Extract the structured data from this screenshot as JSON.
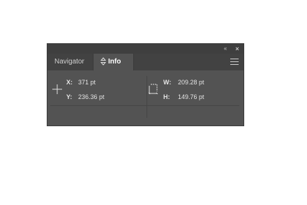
{
  "window": {
    "collapse_icon": "«",
    "close_icon": "×"
  },
  "tabs": [
    {
      "label": "Navigator",
      "active": false
    },
    {
      "label": "Info",
      "active": true
    }
  ],
  "info": {
    "x_label": "X:",
    "x_value": "371 pt",
    "y_label": "Y:",
    "y_value": "236.36 pt",
    "w_label": "W:",
    "w_value": "209.28 pt",
    "h_label": "H:",
    "h_value": "149.76 pt"
  },
  "icons": {
    "position": "crosshair-icon",
    "size": "rectangle-size-icon",
    "menu": "hamburger-menu-icon",
    "tab_arrows": "up-down-arrows-icon"
  },
  "colors": {
    "panel_bg": "#535353",
    "tabbar_bg": "#424242",
    "titlebar_bg": "#3f3f3f",
    "text": "#e4e4e4"
  }
}
